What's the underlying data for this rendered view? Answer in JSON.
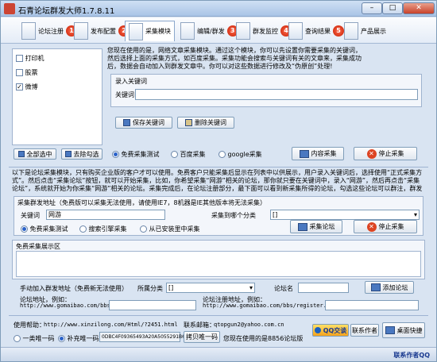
{
  "window": {
    "title": "石青论坛群发大师1.7.8.11",
    "btn_min": "–",
    "btn_max": "□",
    "btn_close": "✕"
  },
  "toolbar": {
    "items": [
      {
        "label": "论坛注册",
        "badge": "1"
      },
      {
        "label": "发布配置",
        "badge": "2"
      },
      {
        "label": "采集模块",
        "badge": ""
      },
      {
        "label": "编辑/群发",
        "badge": "3"
      },
      {
        "label": "群发监控",
        "badge": "4"
      },
      {
        "label": "查询结果",
        "badge": "5"
      },
      {
        "label": "产品展示",
        "badge": ""
      }
    ]
  },
  "keyword_list": {
    "items": [
      {
        "label": "打印机",
        "checked": false
      },
      {
        "label": "股票",
        "checked": false
      },
      {
        "label": "微博",
        "checked": true
      }
    ]
  },
  "desc_top": "您现在使用的是，网络文章采集模块。通过这个模块，你可以先设置你需要采集的关键词，然后选择上面的采集方式，如百度采集。采集功能会搜索与关键词有关的文章来，采集成功后，数据会自动加入到群发文章中。你可以对这些数据进行修改及“伪原创”处理!",
  "keyword_group": {
    "title": "录入关键词",
    "label": "关键词",
    "value": ""
  },
  "btn_save_keyword": "保存关键词",
  "btn_delete_keyword": "删除关键词",
  "btn_select_all": "全部选中",
  "btn_deselect": "去除勾选",
  "engines": {
    "free": "免费采集测试",
    "baidu": "百度采集",
    "google": "google采集"
  },
  "btn_content_collect": "内容采集",
  "btn_stop_1": "停止采集",
  "desc_mid": "以下是论坛采集模块，只有购买企业版的客户才可以使用。免费客户只能采集后显示在列表中以供展示，用户录入关键词后，选择使用“正式采集方式”。然后点击“采集论坛”按钮，就可以开始采集，比如，你希望采集“网游”相关的论坛，那你就只要在关键词中，录入“网游”，然后再点击“采集论坛”，系统就开始为你采集“网游”相关的论坛。采集完成后，在论坛注册部分，最下面可以看到新采集所得的论坛，勾选这些论坛可以群注，群发了。",
  "forum_group": {
    "title": "采集群发地址（免费版可以采集无法使用，请使用IE7，8机器是IE其他版本将无法采集）",
    "keyword_label": "关键词",
    "keyword_value": "网游",
    "category_label": "采集到哪个分类",
    "category_value": "[]",
    "modes": {
      "free": "免费采集测试",
      "search": "搜索引擎采集",
      "registered": "从已安装里中采集"
    },
    "btn_collect": "采集论坛",
    "btn_stop": "停止采集"
  },
  "display_area": {
    "title": "免费采集展示区",
    "content": ""
  },
  "manual_add": {
    "label": "手动加入群发地址（免费新无法使用）",
    "category_label": "所属分类",
    "category_value": "[]",
    "name_label": "论坛名",
    "name_value": "",
    "btn_add": "添加论坛",
    "url_label": "论坛地址，例如：",
    "url_example": "http://www.gomaibao.com/bbs/",
    "reg_label": "论坛注册地址，例如：",
    "reg_example": "http://www.gomaibao.com/bbs/register.php"
  },
  "footer": {
    "help_label": "使用帮助：",
    "help_url": "http://www.xinzilong.com/Html/?2451.html",
    "contact_label": "联系邮箱：",
    "contact_email": "qtopgun2@yahoo.com.cn",
    "btn_qq": "QQ交谈",
    "btn_contact": "联系作者",
    "btn_desktop": "桌面快捷",
    "machine_one": "一类唯一码",
    "machine_two": "补充唯一码",
    "machine_code": "0DBC4F09365493A20A5055291B6",
    "btn_copy": "拷贝唯一码",
    "version_note": "您现在使用的是8856论坛版",
    "author_link": "联系作者QQ"
  }
}
